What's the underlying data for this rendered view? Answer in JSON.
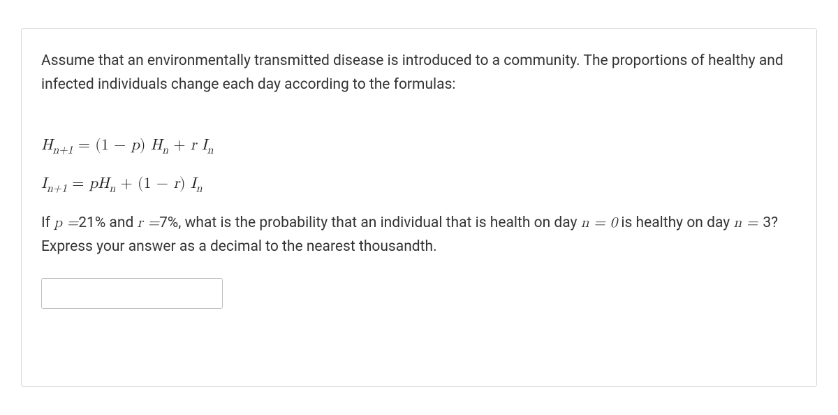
{
  "intro": "Assume that an environmentally transmitted disease is introduced to a community. The proportions of healthy and infected individuals change each day according to the formulas:",
  "formula1_lhs_base": "H",
  "formula1_lhs_sub": "n+1",
  "formula1_eq": " = ",
  "formula1_rhs_open": "(1 − ",
  "formula1_rhs_p": "p",
  "formula1_rhs_close": ") ",
  "formula1_rhs_H": "H",
  "formula1_rhs_Hsub": "n",
  "formula1_rhs_plus": " + ",
  "formula1_rhs_r": "r ",
  "formula1_rhs_I": "I",
  "formula1_rhs_Isub": "n",
  "formula2_lhs_base": "I",
  "formula2_lhs_sub": "n+1",
  "formula2_eq": " = ",
  "formula2_rhs_p": "p",
  "formula2_rhs_H": "H",
  "formula2_rhs_Hsub": "n",
  "formula2_rhs_plus": " + ",
  "formula2_rhs_open": "(1 − ",
  "formula2_rhs_r": "r",
  "formula2_rhs_close": ") ",
  "formula2_rhs_I": "I",
  "formula2_rhs_Isub": "n",
  "q_part1": "If ",
  "q_p": "p ",
  "q_eq1": "=",
  "q_pval": "21% and ",
  "q_r": "r ",
  "q_eq2": "=",
  "q_rval": "7%, what is the probability that an individual that is health on day ",
  "q_n1": "n ",
  "q_eq3": "= 0",
  "q_part2": " is healthy on day ",
  "q_n2": "n ",
  "q_eq4": "= ",
  "q_nval": "3? Express your answer as a decimal to the nearest thousandth.",
  "answer_value": ""
}
